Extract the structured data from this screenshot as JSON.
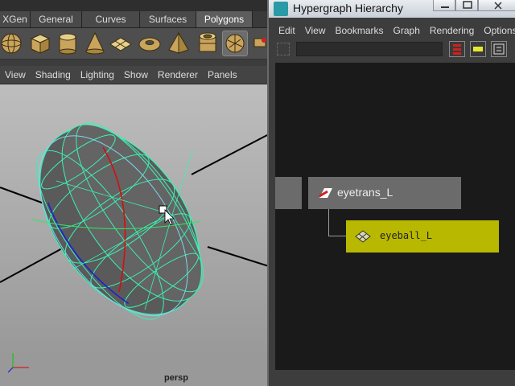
{
  "shelf": {
    "tabs": [
      {
        "label": "XGen",
        "active": false
      },
      {
        "label": "General",
        "active": false
      },
      {
        "label": "Curves",
        "active": false
      },
      {
        "label": "Surfaces",
        "active": false
      },
      {
        "label": "Polygons",
        "active": true
      }
    ],
    "icons": [
      "sphere-icon",
      "cube-icon",
      "cylinder-icon",
      "cone-icon",
      "plane-icon",
      "torus-icon",
      "pyramid-icon",
      "pipe-icon",
      "smooth-icon"
    ]
  },
  "viewport": {
    "menu": [
      "View",
      "Shading",
      "Lighting",
      "Show",
      "Renderer",
      "Panels"
    ],
    "camera_label": "persp",
    "colors": {
      "wireframe": "#3cf0b4",
      "x_axis": "#d01010",
      "y_axis": "#2020d0"
    }
  },
  "hypergraph": {
    "title": "Hypergraph Hierarchy",
    "menu": [
      "Edit",
      "View",
      "Bookmarks",
      "Graph",
      "Rendering",
      "Options"
    ],
    "nodes": {
      "parent": {
        "label": "eyetrans_L"
      },
      "child": {
        "label": "eyeball_L",
        "color": "#b8b800"
      }
    }
  }
}
